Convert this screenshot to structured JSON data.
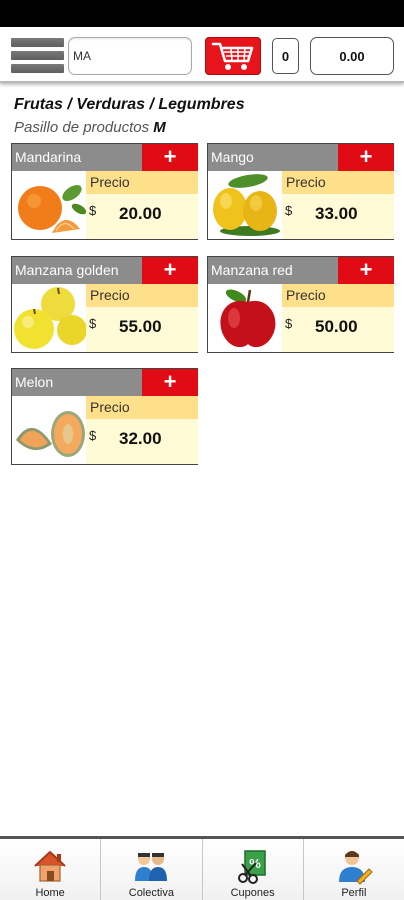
{
  "header": {
    "search_value": "MA",
    "cart_count": "0",
    "cart_total": "0.00"
  },
  "section": {
    "category": "Frutas / Verduras / Legumbres",
    "aisle_prefix": "Pasillo de productos",
    "aisle_letter": "M"
  },
  "products": [
    {
      "name": "Mandarina",
      "add_label": "+",
      "price_label": "Precio",
      "currency": "$",
      "price": "20.00",
      "icon": "mandarin-image"
    },
    {
      "name": "Mango",
      "add_label": "+",
      "price_label": "Precio",
      "currency": "$",
      "price": "33.00",
      "icon": "mango-image"
    },
    {
      "name": "Manzana golden",
      "add_label": "+",
      "price_label": "Precio",
      "currency": "$",
      "price": "55.00",
      "icon": "golden-apple-image"
    },
    {
      "name": "Manzana red",
      "add_label": "+",
      "price_label": "Precio",
      "currency": "$",
      "price": "50.00",
      "icon": "red-apple-image"
    },
    {
      "name": "Melon",
      "add_label": "+",
      "price_label": "Precio",
      "currency": "$",
      "price": "32.00",
      "icon": "melon-image"
    }
  ],
  "nav": [
    {
      "label": "Home",
      "icon": "house-icon"
    },
    {
      "label": "Colectiva",
      "icon": "people-icon"
    },
    {
      "label": "Cupones",
      "icon": "coupon-icon"
    },
    {
      "label": "Perfil",
      "icon": "user-edit-icon"
    }
  ],
  "colors": {
    "accent_red": "#e00b14",
    "name_bar_gray": "#8c8c8c",
    "price_label_yellow": "#ffe08a",
    "price_area_cream": "#fffbd6"
  }
}
